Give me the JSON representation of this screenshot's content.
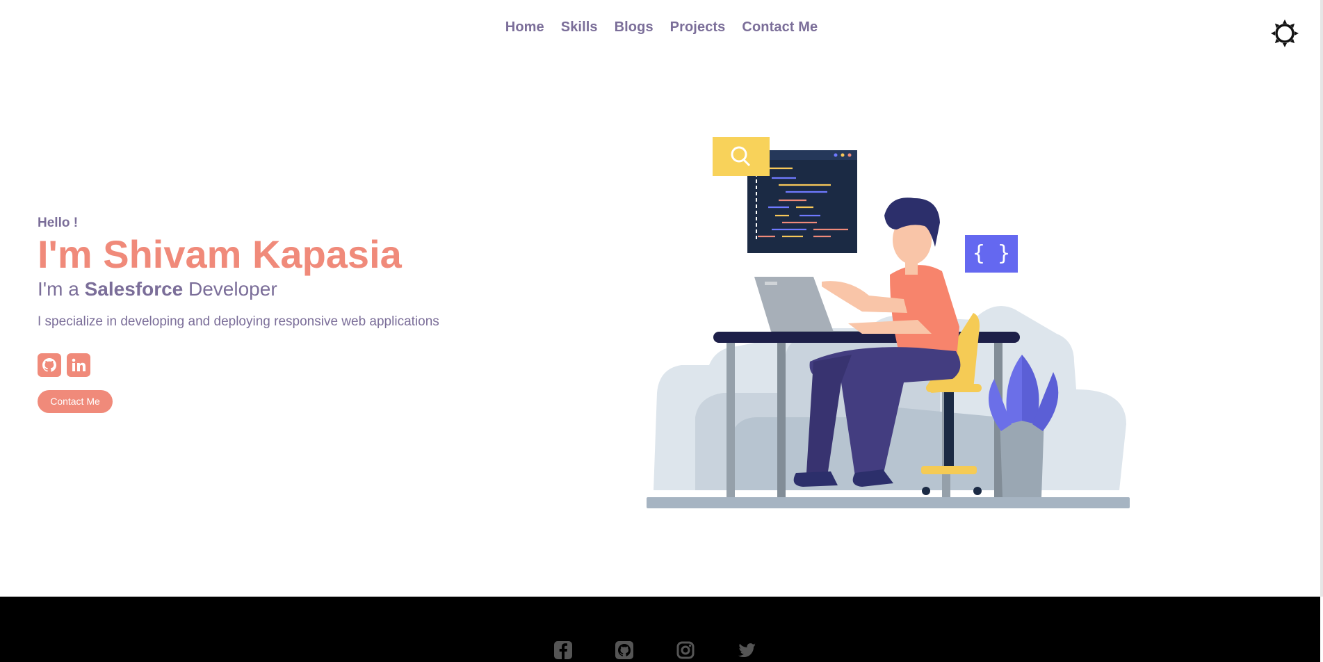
{
  "nav": {
    "items": [
      {
        "label": "Home"
      },
      {
        "label": "Skills"
      },
      {
        "label": "Blogs"
      },
      {
        "label": "Projects"
      },
      {
        "label": "Contact Me"
      }
    ],
    "theme_icon": "sun-icon"
  },
  "hero": {
    "greeting": "Hello !",
    "name": "I'm Shivam Kapasia",
    "role_prefix": "I'm a",
    "role_highlight": "Salesforce",
    "role_suffix": "Developer",
    "description": "I specialize in developing and deploying responsive web applications",
    "socials": [
      {
        "icon": "github-icon"
      },
      {
        "icon": "linkedin-icon"
      }
    ],
    "contact_button": "Contact Me"
  },
  "footer": {
    "icons": [
      "facebook-icon",
      "github-icon",
      "instagram-icon",
      "twitter-icon"
    ]
  },
  "colors": {
    "accent": "#f08a7a",
    "text": "#7b6e99",
    "footer_bg": "#000000"
  }
}
